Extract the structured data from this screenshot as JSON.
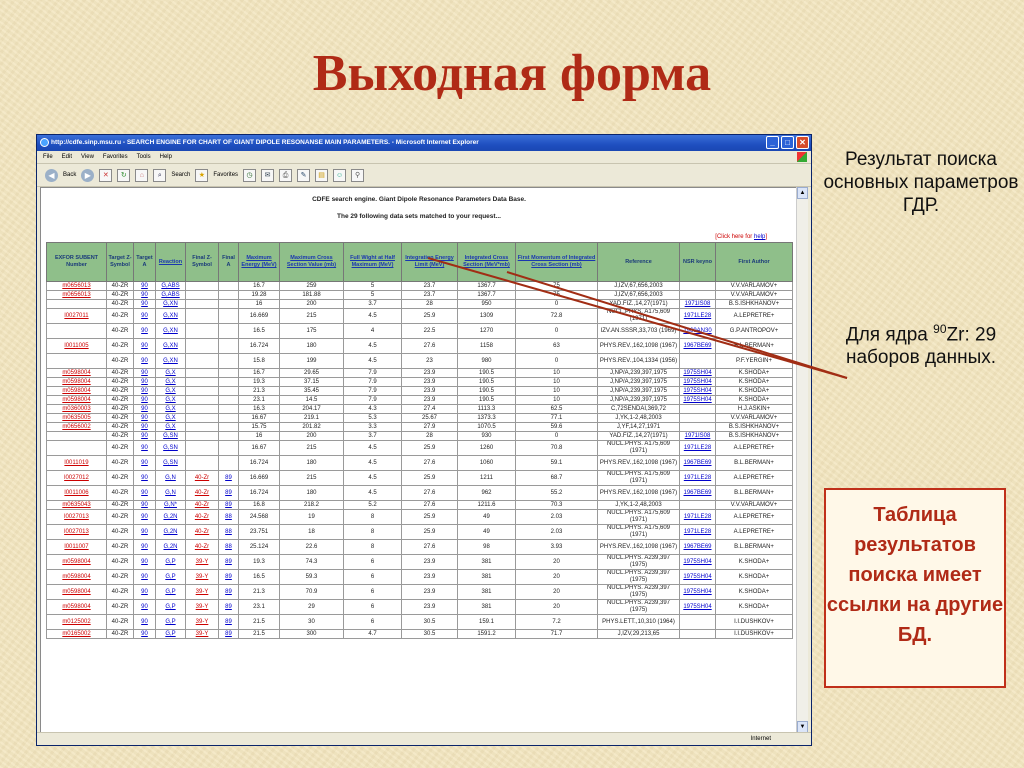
{
  "slide": {
    "title": "Выходная форма"
  },
  "browser": {
    "title": "http://cdfe.sinp.msu.ru - SEARCH ENGINE FOR CHART OF GIANT DIPOLE RESONANSE MAIN PARAMETERS. - Microsoft Internet Explorer",
    "menu": [
      "File",
      "Edit",
      "View",
      "Favorites",
      "Tools",
      "Help"
    ],
    "toolbar": {
      "back": "Back",
      "search": "Search",
      "favorites": "Favorites"
    },
    "status_zone": "Internet"
  },
  "page": {
    "heading": "CDFE search engine. Giant Dipole Resonance Parameters Data Base.",
    "subheading": "The 29 following data sets matched to your request...",
    "help_prefix": "[Click here for ",
    "help_link": "help",
    "help_suffix": "]"
  },
  "table": {
    "headers": [
      "EXFOR SUBENT Number",
      "Target Z-Symbol",
      "Target A",
      "Reaction",
      "Final Z-Symbol",
      "Final A",
      "Maximum Energy (MeV)",
      "Maximum Cross Section Value (mb)",
      "Full Wight at Half Maximum (MeV)",
      "Integration Energy Limit (MeV)",
      "Integrated Cross Section (MeV*mb)",
      "First Momentum of Integrated Cross Section (mb)",
      "Reference",
      "NSR keyno",
      "First Author"
    ],
    "rows": [
      {
        "tall": false,
        "c": [
          "m0656013",
          "40-ZR",
          "90",
          "G,ABS",
          "",
          "",
          "16.7",
          "259",
          "5",
          "23.7",
          "1367.7",
          "75",
          "J,IZV,67,656,2003",
          "",
          "V.V.VARLAMOV+"
        ]
      },
      {
        "tall": false,
        "c": [
          "m0656013",
          "40-ZR",
          "90",
          "G,ABS",
          "",
          "",
          "19.28",
          "181.88",
          "5",
          "23.7",
          "1367.7",
          "75",
          "J,IZV,67,656,2003",
          "",
          "V.V.VARLAMOV+"
        ]
      },
      {
        "tall": false,
        "c": [
          "",
          "40-ZR",
          "90",
          "G,XN",
          "",
          "",
          "16",
          "200",
          "3.7",
          "28",
          "950",
          "0",
          "YAD.FIZ.,14,27(1971)",
          "1971IS08",
          "B.S.ISHKHANOV+"
        ]
      },
      {
        "tall": true,
        "c": [
          "l0027011",
          "40-ZR",
          "90",
          "G,XN",
          "",
          "",
          "16.669",
          "215",
          "4.5",
          "25.9",
          "1309",
          "72.8",
          "NUCL.PHYS. A175,609 (1971)",
          "1971LE28",
          "A.LEPRETRE+"
        ]
      },
      {
        "tall": true,
        "c": [
          "",
          "40-ZR",
          "90",
          "G,XN",
          "",
          "",
          "16.5",
          "175",
          "4",
          "22.5",
          "1270",
          "0",
          "IZV.AN.SSSR,33,703 (1969)",
          "1969AN30",
          "G.P.ANTROPOV+"
        ]
      },
      {
        "tall": true,
        "c": [
          "l0011005",
          "40-ZR",
          "90",
          "G,XN",
          "",
          "",
          "16.724",
          "180",
          "4.5",
          "27.6",
          "1158",
          "63",
          "PHYS.REV.,162,1098 (1967)",
          "1967BE69",
          "B.L.BERMAN+"
        ]
      },
      {
        "tall": true,
        "c": [
          "",
          "40-ZR",
          "90",
          "G,XN",
          "",
          "",
          "15.8",
          "199",
          "4.5",
          "23",
          "980",
          "0",
          "PHYS.REV.,104,1334 (1956)",
          "",
          "P.F.YERGIN+"
        ]
      },
      {
        "tall": false,
        "c": [
          "m0598004",
          "40-ZR",
          "90",
          "G,X",
          "",
          "",
          "16.7",
          "29.65",
          "7.9",
          "23.9",
          "190.5",
          "10",
          "J,NP/A,239,397,1975",
          "1975SH04",
          "K.SHODA+"
        ]
      },
      {
        "tall": false,
        "c": [
          "m0598004",
          "40-ZR",
          "90",
          "G,X",
          "",
          "",
          "19.3",
          "37.15",
          "7.9",
          "23.9",
          "190.5",
          "10",
          "J,NP/A,239,397,1975",
          "1975SH04",
          "K.SHODA+"
        ]
      },
      {
        "tall": false,
        "c": [
          "m0598004",
          "40-ZR",
          "90",
          "G,X",
          "",
          "",
          "21.3",
          "35.45",
          "7.9",
          "23.9",
          "190.5",
          "10",
          "J,NP/A,239,397,1975",
          "1975SH04",
          "K.SHODA+"
        ]
      },
      {
        "tall": false,
        "c": [
          "m0598004",
          "40-ZR",
          "90",
          "G,X",
          "",
          "",
          "23.1",
          "14.5",
          "7.9",
          "23.9",
          "190.5",
          "10",
          "J,NP/A,239,397,1975",
          "1975SH04",
          "K.SHODA+"
        ]
      },
      {
        "tall": false,
        "c": [
          "m0360003",
          "40-ZR",
          "90",
          "G,X",
          "",
          "",
          "16.3",
          "204.17",
          "4.3",
          "27.4",
          "1113.3",
          "62.5",
          "C,72SENDAI,369,72",
          "",
          "H.J.ASKIN+"
        ]
      },
      {
        "tall": false,
        "c": [
          "m0635005",
          "40-ZR",
          "90",
          "G,X",
          "",
          "",
          "16.67",
          "219.1",
          "5.3",
          "25.67",
          "1373.3",
          "77.1",
          "J,YK,1-2,48,2003",
          "",
          "V.V.VARLAMOV+"
        ]
      },
      {
        "tall": false,
        "c": [
          "m0656002",
          "40-ZR",
          "90",
          "G,X",
          "",
          "",
          "15.75",
          "201.82",
          "3.3",
          "27.9",
          "1070.5",
          "59.6",
          "J,YF,14,27,1971",
          "",
          "B.S.ISHKHANOV+"
        ]
      },
      {
        "tall": false,
        "c": [
          "",
          "40-ZR",
          "90",
          "G,SN",
          "",
          "",
          "16",
          "200",
          "3.7",
          "28",
          "930",
          "0",
          "YAD.FIZ.,14,27(1971)",
          "1971IS08",
          "B.S.ISHKHANOV+"
        ]
      },
      {
        "tall": true,
        "c": [
          "",
          "40-ZR",
          "90",
          "G,SN",
          "",
          "",
          "16.67",
          "215",
          "4.5",
          "25.9",
          "1260",
          "70.8",
          "NUCL.PHYS. A175,609 (1971)",
          "1971LE28",
          "A.LEPRETRE+"
        ]
      },
      {
        "tall": true,
        "c": [
          "l0011019",
          "40-ZR",
          "90",
          "G,SN",
          "",
          "",
          "16.724",
          "180",
          "4.5",
          "27.6",
          "1060",
          "59.1",
          "PHYS.REV.,162,1098 (1967)",
          "1967BE69",
          "B.L.BERMAN+"
        ]
      },
      {
        "tall": true,
        "c": [
          "l0027012",
          "40-ZR",
          "90",
          "G,N",
          "40-Zr",
          "89",
          "16.669",
          "215",
          "4.5",
          "25.9",
          "1211",
          "68.7",
          "NUCL.PHYS. A175,609 (1971)",
          "1971LE28",
          "A.LEPRETRE+"
        ]
      },
      {
        "tall": true,
        "c": [
          "l0011006",
          "40-ZR",
          "90",
          "G,N",
          "40-Zr",
          "89",
          "16.724",
          "180",
          "4.5",
          "27.6",
          "962",
          "55.2",
          "PHYS.REV.,162,1098 (1967)",
          "1967BE69",
          "B.L.BERMAN+"
        ]
      },
      {
        "tall": false,
        "c": [
          "m0635043",
          "40-ZR",
          "90",
          "G,N*",
          "40-Zr",
          "89",
          "16.8",
          "218.2",
          "5.2",
          "27.6",
          "1211.6",
          "70.3",
          "J,YK,1-2,48,2003",
          "",
          "V.V.VARLAMOV+"
        ]
      },
      {
        "tall": true,
        "c": [
          "l0027013",
          "40-ZR",
          "90",
          "G,2N",
          "40-Zr",
          "88",
          "24.568",
          "19",
          "8",
          "25.9",
          "49",
          "2.03",
          "NUCL.PHYS. A175,609 (1971)",
          "1971LE28",
          "A.LEPRETRE+"
        ]
      },
      {
        "tall": true,
        "c": [
          "l0027013",
          "40-ZR",
          "90",
          "G,2N",
          "40-Zr",
          "88",
          "23.751",
          "18",
          "8",
          "25.9",
          "49",
          "2.03",
          "NUCL.PHYS. A175,609 (1971)",
          "1971LE28",
          "A.LEPRETRE+"
        ]
      },
      {
        "tall": true,
        "c": [
          "l0011007",
          "40-ZR",
          "90",
          "G,2N",
          "40-Zr",
          "88",
          "25.124",
          "22.6",
          "8",
          "27.6",
          "98",
          "3.93",
          "PHYS.REV.,162,1098 (1967)",
          "1967BE69",
          "B.L.BERMAN+"
        ]
      },
      {
        "tall": true,
        "c": [
          "m0598004",
          "40-ZR",
          "90",
          "G,P",
          "39-Y",
          "89",
          "19.3",
          "74.3",
          "6",
          "23.9",
          "381",
          "20",
          "NUCL.PHYS. A239,397 (1975)",
          "1975SH04",
          "K.SHODA+"
        ]
      },
      {
        "tall": true,
        "c": [
          "m0598004",
          "40-ZR",
          "90",
          "G,P",
          "39-Y",
          "89",
          "16.5",
          "59.3",
          "6",
          "23.9",
          "381",
          "20",
          "NUCL.PHYS. A239,397 (1975)",
          "1975SH04",
          "K.SHODA+"
        ]
      },
      {
        "tall": true,
        "c": [
          "m0598004",
          "40-ZR",
          "90",
          "G,P",
          "39-Y",
          "89",
          "21.3",
          "70.9",
          "6",
          "23.9",
          "381",
          "20",
          "NUCL.PHYS. A239,397 (1975)",
          "1975SH04",
          "K.SHODA+"
        ]
      },
      {
        "tall": true,
        "c": [
          "m0598004",
          "40-ZR",
          "90",
          "G,P",
          "39-Y",
          "89",
          "23.1",
          "29",
          "6",
          "23.9",
          "381",
          "20",
          "NUCL.PHYS. A239,397 (1975)",
          "1975SH04",
          "K.SHODA+"
        ]
      },
      {
        "tall": true,
        "c": [
          "m0125002",
          "40-ZR",
          "90",
          "G,P",
          "39-Y",
          "89",
          "21.5",
          "30",
          "6",
          "30.5",
          "159.1",
          "7.2",
          "PHYS.LETT.,10,310 (1964)",
          "",
          "I.I.DUSHKOV+"
        ]
      },
      {
        "tall": false,
        "c": [
          "m0165002",
          "40-ZR",
          "90",
          "G,P",
          "39-Y",
          "89",
          "21.5",
          "300",
          "4.7",
          "30.5",
          "1591.2",
          "71.7",
          "J,IZV,29,213,65",
          "",
          "I.I.DUSHKOV+"
        ]
      }
    ]
  },
  "side_note": {
    "line1": "Результат поиска основных параметров ГДР.",
    "line2_prefix": "Для ядра ",
    "line2_sup": "90",
    "line2_suffix": "Zr: 29 наборов данных."
  },
  "callout": {
    "text": "Таблица результатов поиска имеет ссылки на другие БД."
  },
  "colors": {
    "title": "#b02a16",
    "header_bg": "#8fbf8a",
    "link": "#0000cc",
    "callout_border": "#c0301a"
  }
}
